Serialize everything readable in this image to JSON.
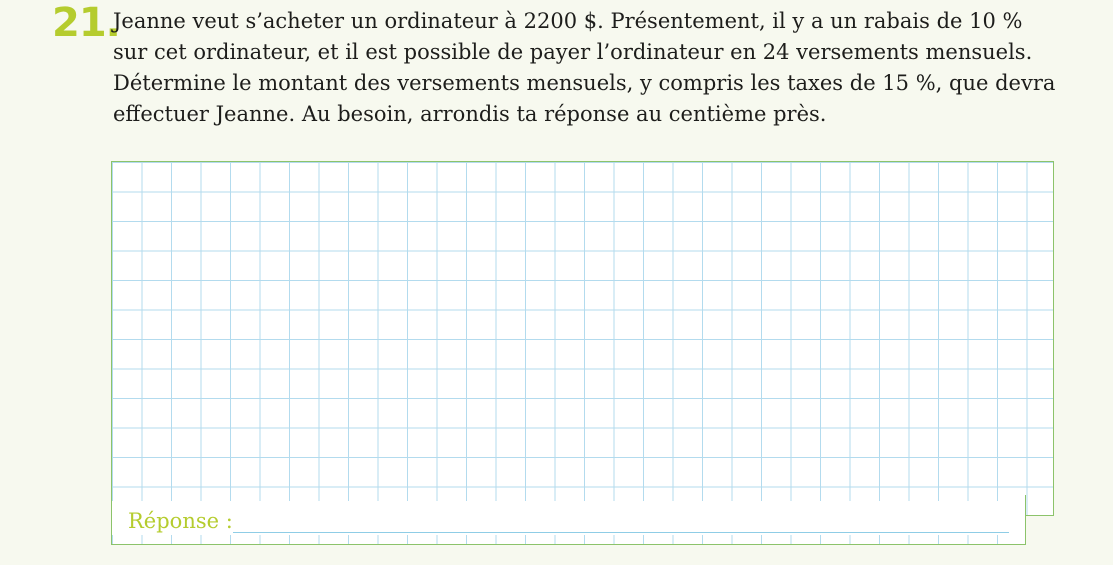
{
  "question": {
    "number": "21.",
    "lines": [
      "Jeanne veut s’acheter un ordinateur à 2200 $. Présentement, il y a un rabais de 10 %",
      "sur cet ordinateur, et il est possible de payer l’ordinateur en 24 versements mensuels.",
      "Détermine le montant des versements mensuels, y compris les taxes de 15 %, que devra",
      "effectuer Jeanne. Au besoin, arrondis ta réponse au centième près."
    ]
  },
  "answer": {
    "label": "Réponse :",
    "value": ""
  },
  "colors": {
    "accent": "#b5cc2e",
    "border": "#8cc36a",
    "grid": "#b3dbee",
    "text": "#1d1d1b"
  }
}
